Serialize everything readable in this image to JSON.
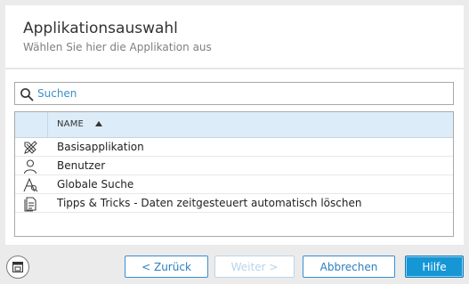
{
  "header": {
    "title": "Applikationsauswahl",
    "subtitle": "Wählen Sie hier die Applikation aus"
  },
  "search": {
    "value": "",
    "placeholder": "Suchen",
    "icon": "search-icon"
  },
  "table": {
    "column_header": "NAME",
    "sort": "ascending",
    "rows": [
      {
        "label": "Basisapplikation",
        "icon": "tools-icon"
      },
      {
        "label": "Benutzer",
        "icon": "user-icon"
      },
      {
        "label": "Globale Suche",
        "icon": "global-search-icon"
      },
      {
        "label": "Tipps & Tricks - Daten zeitgesteuert automatisch löschen",
        "icon": "document-icon"
      }
    ]
  },
  "footer": {
    "corner_icon": "window-icon",
    "back_label": "< Zurück",
    "next_label": "Weiter >",
    "cancel_label": "Abbrechen",
    "help_label": "Hilfe"
  },
  "colors": {
    "accent": "#1597d6",
    "link": "#3c8fc8",
    "header_bg": "#dcecf8"
  }
}
